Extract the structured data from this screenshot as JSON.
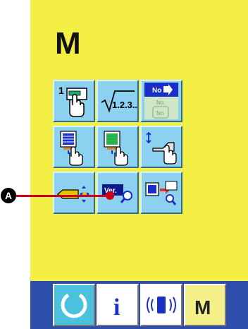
{
  "screen": {
    "title": "M",
    "background": "#f3ef45"
  },
  "buttons": [
    {
      "id": "pattern-program",
      "number": "1",
      "icon": "sewing-data-hand-icon"
    },
    {
      "id": "step-numbers",
      "label": "1.2.3..",
      "icon": "sqrt-123-icon"
    },
    {
      "id": "no-select",
      "label": "No",
      "icons": [
        "no-arrow-icon",
        "no-stack-icon"
      ]
    },
    {
      "id": "data-edit-1",
      "icon": "data-edit-hand-icon"
    },
    {
      "id": "data-edit-2",
      "icon": "data-edit-green-hand-icon"
    },
    {
      "id": "setting-hand",
      "icon": "hand-slide-icon"
    },
    {
      "id": "thread-move",
      "icon": "arrow-move-icon"
    },
    {
      "id": "version",
      "label": "Ver.",
      "icon": "version-search-icon"
    },
    {
      "id": "transfer",
      "icon": "transfer-search-icon"
    }
  ],
  "bottom_bar": {
    "background": "#2d4eaa",
    "items": [
      {
        "id": "reset",
        "icon": "circle-arc-icon",
        "bg": "#4ac2de"
      },
      {
        "id": "info",
        "label": "i",
        "icon": "info-icon",
        "bg": "#ffffff"
      },
      {
        "id": "communication",
        "icon": "communication-icon",
        "bg": "#ffffff"
      },
      {
        "id": "mode",
        "label": "M",
        "icon": "mode-icon",
        "bg": "#f6f08a"
      }
    ]
  },
  "annotation": {
    "marker": "A",
    "color": "#d0001c"
  }
}
